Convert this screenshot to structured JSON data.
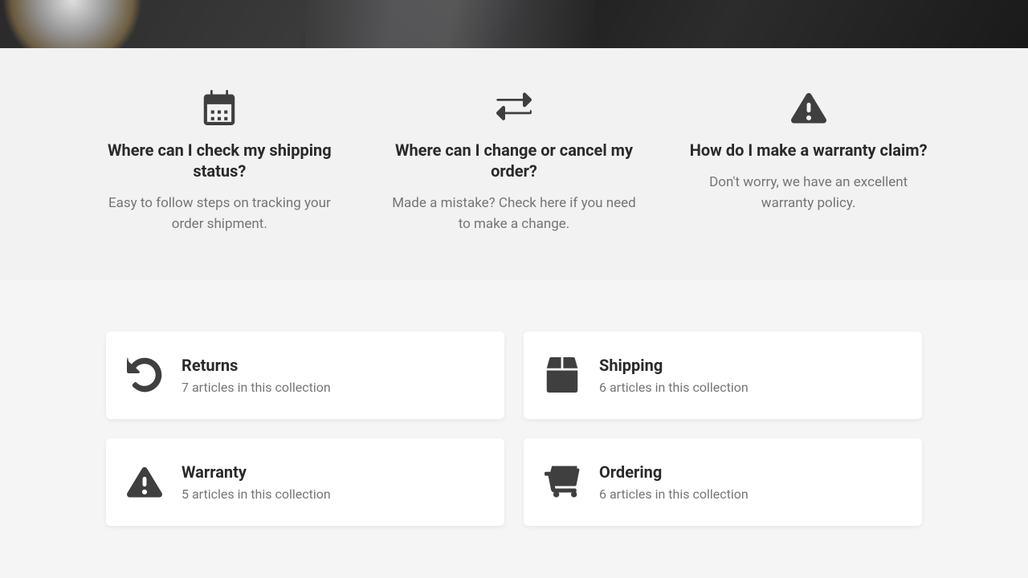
{
  "featured": [
    {
      "title": "Where can I check my shipping status?",
      "desc": "Easy to follow steps on tracking your order shipment."
    },
    {
      "title": "Where can I change or cancel my order?",
      "desc": "Made a mistake? Check here if you need to make a change."
    },
    {
      "title": "How do I make a warranty claim?",
      "desc": "Don't worry, we have an excellent warranty policy."
    }
  ],
  "collections": [
    {
      "title": "Returns",
      "meta": "7 articles in this collection"
    },
    {
      "title": "Shipping",
      "meta": "6 articles in this collection"
    },
    {
      "title": "Warranty",
      "meta": "5 articles in this collection"
    },
    {
      "title": "Ordering",
      "meta": "6 articles in this collection"
    }
  ]
}
